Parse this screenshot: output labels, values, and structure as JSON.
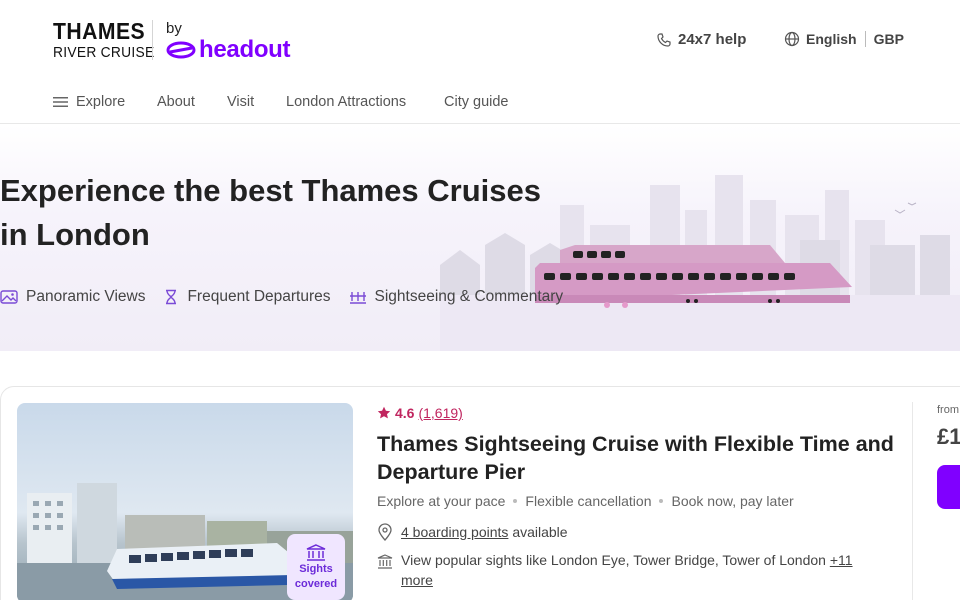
{
  "brand": {
    "logo_line1": "THAMES",
    "logo_line2": "RIVER CRUISE",
    "by": "by",
    "partner": "headout"
  },
  "header": {
    "help": "24x7 help",
    "language": "English",
    "currency": "GBP"
  },
  "nav": {
    "items": [
      "Explore",
      "About",
      "Visit",
      "London Attractions",
      "City guide"
    ]
  },
  "hero": {
    "title_line1": "Experience the best Thames Cruises",
    "title_line2": "in London",
    "features": [
      "Panoramic Views",
      "Frequent Departures",
      "Sightseeing & Commentary"
    ]
  },
  "product": {
    "rating": "4.6",
    "reviews": "(1,619)",
    "title": "Thames Sightseeing Cruise with Flexible Time and Departure Pier",
    "meta": [
      "Explore at your pace",
      "Flexible cancellation",
      "Book now, pay later"
    ],
    "boarding_link": "4 boarding points",
    "boarding_suffix": "available",
    "sights_text": "View popular sights like London Eye, Tower Bridge, Tower of London",
    "sights_more": "+11 more",
    "badge_line1": "Sights",
    "badge_line2": "covered",
    "from_label": "from",
    "price": "£1"
  },
  "colors": {
    "brand_purple": "#8000ff",
    "rating_pink": "#c0255f",
    "badge_bg": "#f0e6ff"
  }
}
